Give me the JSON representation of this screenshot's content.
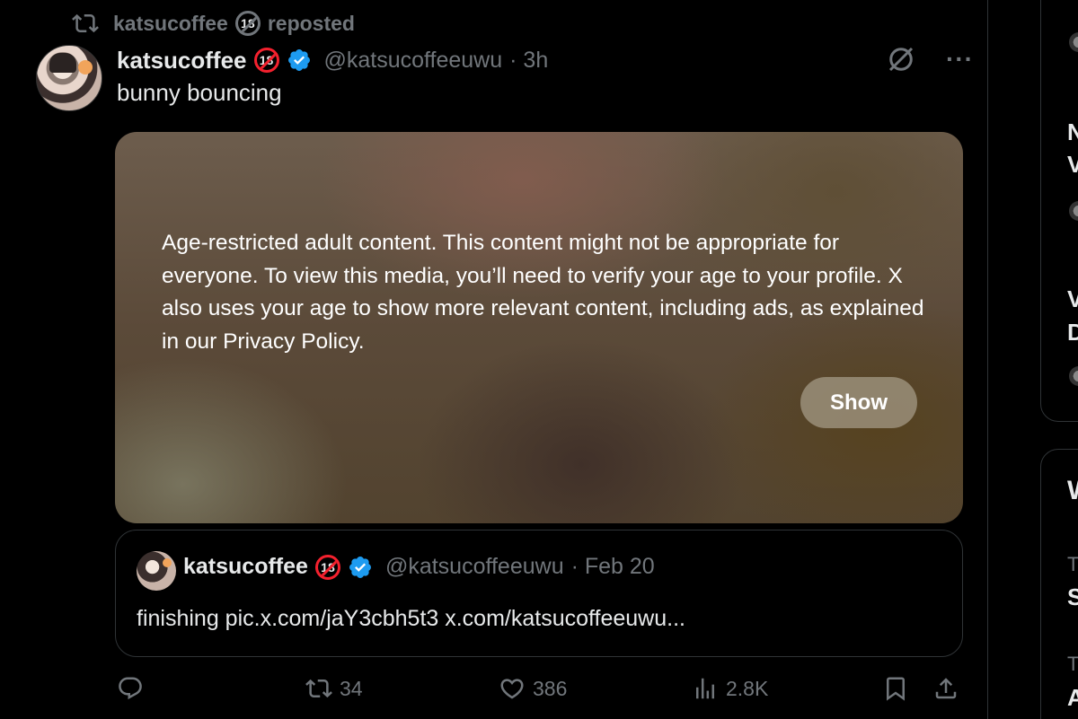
{
  "repost": {
    "user": "katsucoffee",
    "label": "reposted"
  },
  "post": {
    "author_name": "katsucoffee",
    "age_badge": "18",
    "handle": "@katsucoffeeuwu",
    "time": "· 3h",
    "text": "bunny bouncing",
    "more": "···"
  },
  "media_warning": {
    "text": "Age-restricted adult content. This content might not be appropriate for everyone. To view this media, you’ll need to verify your age to your profile. X also uses your age to show more relevant content, including ads, as explained in our Privacy Policy.",
    "button_label": "Show"
  },
  "quote": {
    "author_name": "katsucoffee",
    "age_badge": "18",
    "handle": "@katsucoffeeuwu",
    "time": "· Feb 20",
    "text": "finishing pic.x.com/jaY3cbh5t3 x.com/katsucoffeeuwu..."
  },
  "actions": {
    "reposts": "34",
    "likes": "386",
    "views": "2.8K"
  },
  "sidebar": {
    "letters": [
      "N",
      "V",
      "V",
      "D",
      "W",
      "T",
      "S",
      "T",
      "A"
    ]
  },
  "colors": {
    "background": "#000000",
    "text": "#e7e9ea",
    "muted": "#71767b",
    "verified_blue": "#1d9bf0",
    "age_red": "#f4212e"
  }
}
